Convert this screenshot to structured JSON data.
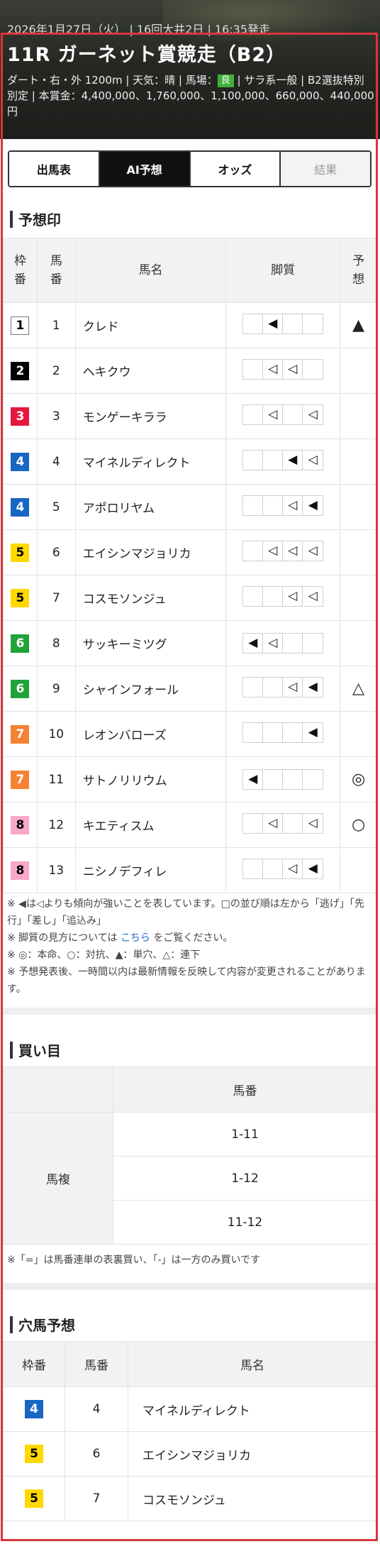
{
  "race": {
    "date_line": "2026年1月27日（火） | 16回大井2日 | 16:35発走",
    "title": "11R ガーネット賞競走（B2）",
    "info_prefix": "ダート・右・外 1200m | 天気：晴 | 馬場：",
    "track_condition": "良",
    "info_suffix": " | サラ系一般 | B2選抜特別 別定 | 本賞金：4,400,000、1,760,000、1,100,000、660,000、440,000円"
  },
  "tabs": [
    {
      "label": "出馬表",
      "state": "normal"
    },
    {
      "label": "AI予想",
      "state": "active"
    },
    {
      "label": "オッズ",
      "state": "normal"
    },
    {
      "label": "結果",
      "state": "disabled"
    }
  ],
  "prediction": {
    "section_title": "予想印",
    "headers": {
      "waku": "枠\n番",
      "umaban": "馬\n番",
      "name": "馬名",
      "kyakushitsu": "脚質",
      "yoso": "予\n想"
    },
    "rows": [
      {
        "waku": "1",
        "umaban": "1",
        "name": "クレド",
        "kyaku": [
          "",
          "◀",
          "",
          ""
        ],
        "mark": "▲"
      },
      {
        "waku": "2",
        "umaban": "2",
        "name": "ヘキクウ",
        "kyaku": [
          "",
          "◁",
          "◁",
          ""
        ],
        "mark": ""
      },
      {
        "waku": "3",
        "umaban": "3",
        "name": "モンゲーキララ",
        "kyaku": [
          "",
          "◁",
          "",
          "◁"
        ],
        "mark": ""
      },
      {
        "waku": "4",
        "umaban": "4",
        "name": "マイネルディレクト",
        "kyaku": [
          "",
          "",
          "◀",
          "◁"
        ],
        "mark": ""
      },
      {
        "waku": "4",
        "umaban": "5",
        "name": "アポロリヤム",
        "kyaku": [
          "",
          "",
          "◁",
          "◀"
        ],
        "mark": ""
      },
      {
        "waku": "5",
        "umaban": "6",
        "name": "エイシンマジョリカ",
        "kyaku": [
          "",
          "◁",
          "◁",
          "◁"
        ],
        "mark": ""
      },
      {
        "waku": "5",
        "umaban": "7",
        "name": "コスモソンジュ",
        "kyaku": [
          "",
          "",
          "◁",
          "◁"
        ],
        "mark": ""
      },
      {
        "waku": "6",
        "umaban": "8",
        "name": "サッキーミツグ",
        "kyaku": [
          "◀",
          "◁",
          "",
          ""
        ],
        "mark": ""
      },
      {
        "waku": "6",
        "umaban": "9",
        "name": "シャインフォール",
        "kyaku": [
          "",
          "",
          "◁",
          "◀"
        ],
        "mark": "△"
      },
      {
        "waku": "7",
        "umaban": "10",
        "name": "レオンバローズ",
        "kyaku": [
          "",
          "",
          "",
          "◀"
        ],
        "mark": ""
      },
      {
        "waku": "7",
        "umaban": "11",
        "name": "サトノリリウム",
        "kyaku": [
          "◀",
          "",
          "",
          ""
        ],
        "mark": "◎"
      },
      {
        "waku": "8",
        "umaban": "12",
        "name": "キエティスム",
        "kyaku": [
          "",
          "◁",
          "",
          "◁"
        ],
        "mark": "○"
      },
      {
        "waku": "8",
        "umaban": "13",
        "name": "ニシノデフィレ",
        "kyaku": [
          "",
          "",
          "◁",
          "◀"
        ],
        "mark": ""
      }
    ],
    "notes": {
      "line1": "※ ◀は◁よりも傾向が強いことを表しています。□の並び順は左から「逃げ」「先行」「差し」「追込み」",
      "line2_prefix": "※ 脚質の見方については ",
      "line2_link": "こちら",
      "line2_suffix": " をご覧ください。",
      "line3": "※ ◎：本命、○：対抗、▲：単穴、△：連下",
      "line4": "※ 予想発表後、一時間以内は最新情報を反映して内容が変更されることがあります。"
    }
  },
  "buy": {
    "section_title": "買い目",
    "header": "馬番",
    "kind": "馬複",
    "combos": [
      "1-11",
      "1-12",
      "11-12"
    ],
    "note": "※「=」は馬番連単の表裏買い、「-」は一方のみ買いです"
  },
  "dark_horse": {
    "section_title": "穴馬予想",
    "headers": {
      "waku": "枠番",
      "umaban": "馬番",
      "name": "馬名"
    },
    "rows": [
      {
        "waku": "4",
        "umaban": "4",
        "name": "マイネルディレクト"
      },
      {
        "waku": "5",
        "umaban": "6",
        "name": "エイシンマジョリカ"
      },
      {
        "waku": "5",
        "umaban": "7",
        "name": "コスモソンジュ"
      }
    ]
  }
}
